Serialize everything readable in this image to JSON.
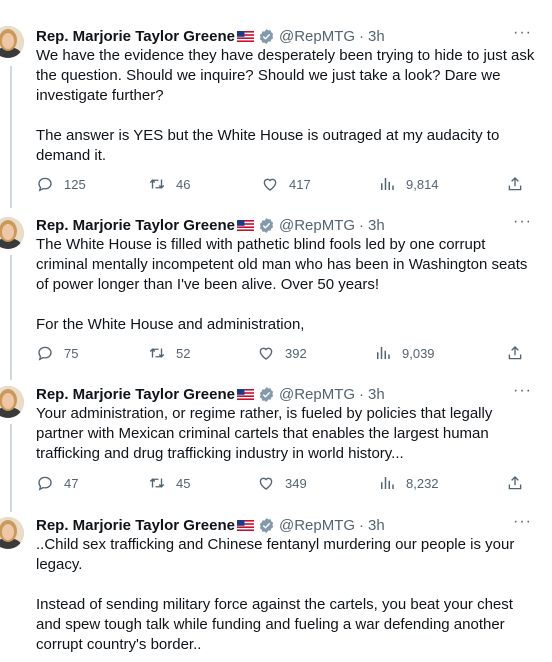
{
  "tweets": [
    {
      "name": "Rep. Marjorie Taylor Greene",
      "handle": "@RepMTG",
      "sep": "·",
      "time": "3h",
      "more": "···",
      "paragraphs": [
        "We have the evidence they have desperately been trying to hide to just ask the question. Should we inquire? Should we just take a look? Dare we investigate further?",
        "The answer is YES but the White House is outraged at my audacity to demand it."
      ],
      "replies": "125",
      "retweets": "46",
      "likes": "417",
      "views": "9,814"
    },
    {
      "name": "Rep. Marjorie Taylor Greene",
      "handle": "@RepMTG",
      "sep": "·",
      "time": "3h",
      "more": "···",
      "paragraphs": [
        "The White House is filled with pathetic blind fools led by one corrupt criminal mentally incompetent old man who has been in Washington seats of power longer than I've been alive. Over 50 years!",
        "For the White House and administration,"
      ],
      "replies": "75",
      "retweets": "52",
      "likes": "392",
      "views": "9,039"
    },
    {
      "name": "Rep. Marjorie Taylor Greene",
      "handle": "@RepMTG",
      "sep": "·",
      "time": "3h",
      "more": "···",
      "paragraphs": [
        "Your administration, or regime rather, is fueled by policies that legally partner with Mexican criminal cartels that enables the largest human trafficking and drug trafficking industry in world history..."
      ],
      "replies": "47",
      "retweets": "45",
      "likes": "349",
      "views": "8,232"
    },
    {
      "name": "Rep. Marjorie Taylor Greene",
      "handle": "@RepMTG",
      "sep": "·",
      "time": "3h",
      "more": "···",
      "paragraphs": [
        "..Child sex trafficking and Chinese fentanyl murdering our people is your legacy.",
        "Instead of sending military force against the cartels, you beat your chest and spew tough talk while funding and fueling a war defending another corrupt country's border.."
      ]
    }
  ],
  "colors": {
    "text": "#0f1419",
    "secondary": "#536471",
    "verified": "#829aab",
    "thread_line": "#cfd9de"
  },
  "icons": [
    "reply-icon",
    "retweet-icon",
    "like-icon",
    "views-icon",
    "share-icon",
    "verified-badge-icon",
    "us-flag-icon",
    "more-icon"
  ]
}
